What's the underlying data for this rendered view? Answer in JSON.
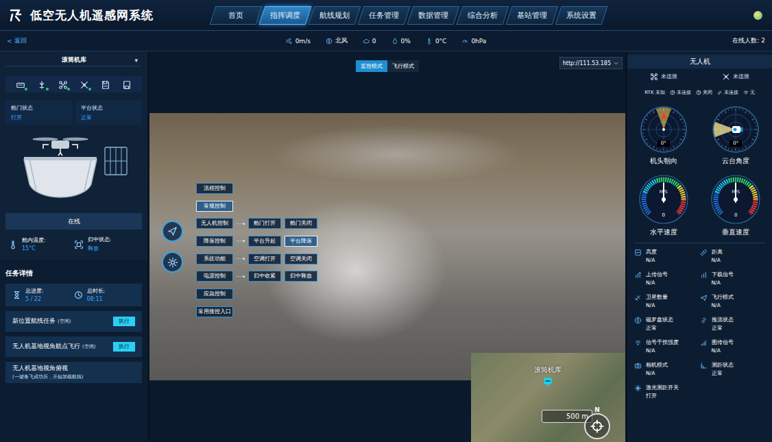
{
  "header": {
    "title": "低空无人机遥感网系统",
    "nav": [
      {
        "label": "首页",
        "selected": false
      },
      {
        "label": "指挥调度",
        "selected": true
      },
      {
        "label": "航线规划",
        "selected": false
      },
      {
        "label": "任务管理",
        "selected": false
      },
      {
        "label": "数据管理",
        "selected": false
      },
      {
        "label": "综合分析",
        "selected": false
      },
      {
        "label": "基站管理",
        "selected": false
      },
      {
        "label": "系统设置",
        "selected": false
      }
    ]
  },
  "subbar": {
    "back_icon": "<",
    "back": "返回",
    "weather": [
      "0m/s",
      "北风",
      "0",
      "0%",
      "0°C",
      "0hPa"
    ],
    "online": "在线人数: 2"
  },
  "hangar": {
    "name": "滚筒机库",
    "dropdown_icon": "▾",
    "toolbar": [
      {
        "online": true
      },
      {
        "online": true
      },
      {
        "online": true
      },
      {
        "online": true
      },
      {
        "online": false
      },
      {
        "online": false
      }
    ],
    "status": [
      {
        "label": "舱门状态",
        "value": "打开"
      },
      {
        "label": "平台状态",
        "value": "正常"
      }
    ],
    "connection": "在线",
    "env": [
      {
        "label": "舱内温度:",
        "value": "15°C"
      },
      {
        "label": "归中状态:",
        "value": "释放"
      }
    ]
  },
  "tasks": {
    "title": "任务详情",
    "summary": [
      {
        "label": "总进度:",
        "value": "5 / 22"
      },
      {
        "label": "总时长:",
        "value": "08:11"
      }
    ],
    "items": [
      {
        "kind": "runnable",
        "name": "新位置航线任务",
        "status": "(空闲)",
        "button": "执行"
      },
      {
        "kind": "runnable",
        "name": "无人机基地视角航点飞行",
        "status": "(空闲)",
        "button": "执行"
      },
      {
        "kind": "info",
        "name": "无人机基地视角俯视",
        "note": "(一键备飞成功后，开始加载航线)"
      }
    ]
  },
  "view": {
    "modes": [
      {
        "label": "监控模式",
        "selected": true
      },
      {
        "label": "飞行模式",
        "selected": false
      }
    ],
    "stream_url": "http://111.53.185"
  },
  "control_menu": {
    "categories": [
      {
        "label": "流程控制",
        "selected": false
      },
      {
        "label": "常规控制",
        "selected": true
      },
      {
        "label": "无人机控制",
        "selected": false
      },
      {
        "label": "降落控制",
        "selected": false
      },
      {
        "label": "系统功能",
        "selected": false
      },
      {
        "label": "电源控制",
        "selected": false
      },
      {
        "label": "应急控制",
        "selected": false
      },
      {
        "label": "常用接控入口",
        "selected": false
      }
    ],
    "actions": [
      [
        {
          "label": "舱门打开",
          "selected": false
        },
        {
          "label": "舱门关闭",
          "selected": false
        }
      ],
      [
        {
          "label": "平台升起",
          "selected": false
        },
        {
          "label": "平台降落",
          "selected": true
        }
      ],
      [
        {
          "label": "空调打开",
          "selected": false
        },
        {
          "label": "空调关闭",
          "selected": false
        }
      ],
      [
        {
          "label": "归中收紧",
          "selected": false
        },
        {
          "label": "归中释放",
          "selected": false
        }
      ]
    ]
  },
  "minimap": {
    "label": "滚筒机库",
    "scale": "500 m",
    "north": "N"
  },
  "drone": {
    "title": "无人机",
    "links": [
      "未连接",
      "未连接"
    ],
    "indicators": [
      "RTK 未知",
      "未连接",
      "关闭",
      "未连接",
      "无"
    ],
    "dials": [
      {
        "kind": "heading",
        "label": "机头朝向",
        "reading": "0°",
        "angle": 0
      },
      {
        "kind": "gimbal",
        "label": "云台角度",
        "reading": "0°",
        "angle": 0
      }
    ],
    "gauges": [
      {
        "label": "水平速度",
        "unit": "M/S",
        "reading": "0",
        "level": 0.5
      },
      {
        "label": "垂直速度",
        "unit": "M/S",
        "reading": "0",
        "level": 0.5
      }
    ],
    "stats": [
      {
        "label": "高度",
        "value": "N/A"
      },
      {
        "label": "距离",
        "value": "N/A"
      },
      {
        "label": "上传信号",
        "value": "N/A"
      },
      {
        "label": "下载信号",
        "value": "N/A"
      },
      {
        "label": "卫星数量",
        "value": "N/A"
      },
      {
        "label": "飞行模式",
        "value": "N/A"
      },
      {
        "label": "磁罗盘状态",
        "value": "正常"
      },
      {
        "label": "推流状态",
        "value": "正常"
      },
      {
        "label": "信号干扰强度",
        "value": "N/A"
      },
      {
        "label": "图传信号",
        "value": "N/A"
      },
      {
        "label": "相机模式",
        "value": "N/A"
      },
      {
        "label": "测距状态",
        "value": "正常"
      },
      {
        "label": "激光测距开关",
        "value": "打开"
      }
    ]
  }
}
